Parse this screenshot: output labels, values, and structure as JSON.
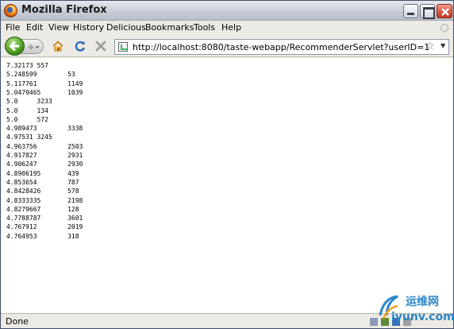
{
  "window": {
    "title": "Mozilla Firefox"
  },
  "menu": {
    "file": "File",
    "edit": "Edit",
    "view": "View",
    "history": "History",
    "delicious": "Delicious",
    "bookmarks": "Bookmarks",
    "tools": "Tools",
    "help": "Help"
  },
  "navigation": {
    "url": "http://localhost:8080/taste-webapp/RecommenderServlet?userID=1"
  },
  "recommendations": [
    "7.32173 557",
    "5.248599        53",
    "5.117761        1149",
    "5.0479465       1039",
    "5.0     3233",
    "5.0     134",
    "5.0     572",
    "4.989473        3338",
    "4.97531 3245",
    "4.963756        2503",
    "4.917827        2931",
    "4.906247        2930",
    "4.8906195       439",
    "4.853654        787",
    "4.8428426       578",
    "4.8333335       2198",
    "4.8279667       128",
    "4.7788787       3601",
    "4.767912        2019",
    "4.764953        318"
  ],
  "status": {
    "text": "Done"
  },
  "watermark": {
    "chinese": "运维网",
    "domain": "iyunv.com"
  },
  "colors": {
    "titlebar": "#c8ccd6",
    "chrome": "#eceae4",
    "watermark": "#2c87c9"
  }
}
